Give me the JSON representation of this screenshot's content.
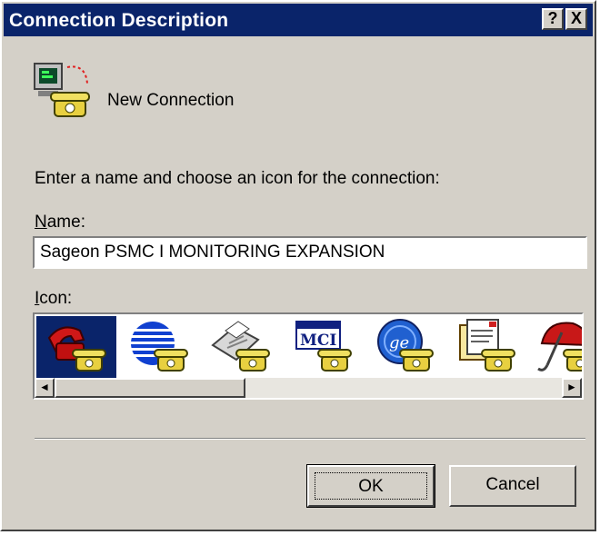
{
  "window": {
    "title": "Connection Description",
    "help_button": "?",
    "close_button": "X"
  },
  "header": {
    "icon": "phone-computer-icon",
    "label": "New Connection"
  },
  "prompt": "Enter a name and choose an icon for the connection:",
  "name_field": {
    "label_accel": "N",
    "label_rest": "ame:",
    "value": "Sageon PSMC I MONITORING EXPANSION"
  },
  "icon_field": {
    "label_accel": "I",
    "label_rest": "con:",
    "items": [
      {
        "icon": "red-phone-icon",
        "selected": true
      },
      {
        "icon": "globe-phone-icon",
        "selected": false
      },
      {
        "icon": "fax-phone-icon",
        "selected": false
      },
      {
        "icon": "mci-phone-icon",
        "selected": false
      },
      {
        "icon": "ge-phone-icon",
        "selected": false
      },
      {
        "icon": "documents-phone-icon",
        "selected": false
      },
      {
        "icon": "umbrella-phone-icon",
        "selected": false
      }
    ],
    "scroll_left": "◄",
    "scroll_right": "►",
    "scroll_position": 0.0
  },
  "buttons": {
    "ok": "OK",
    "cancel": "Cancel"
  },
  "colors": {
    "titlebar": "#0a246a",
    "face": "#d4d0c8",
    "selection": "#0a246a"
  }
}
